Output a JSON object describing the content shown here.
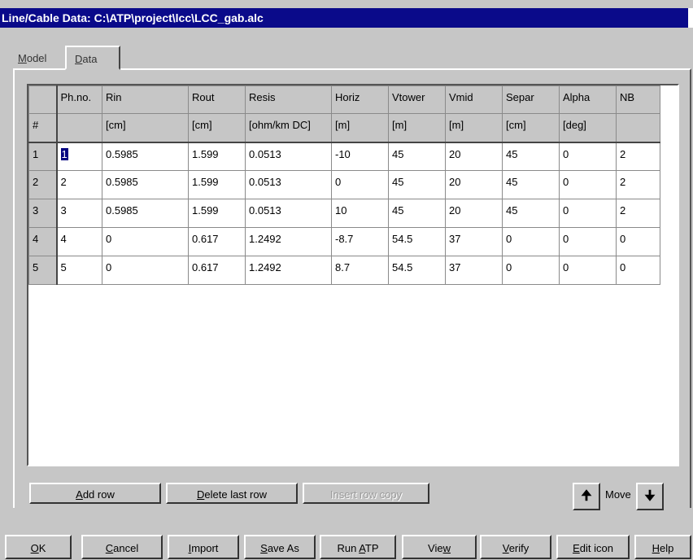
{
  "window": {
    "title": "Line/Cable Data: C:\\ATP\\project\\lcc\\LCC_gab.alc"
  },
  "tabs": [
    {
      "label": "Model",
      "accel": "M",
      "rest": "odel"
    },
    {
      "label": "Data",
      "accel": "D",
      "rest": "ata"
    }
  ],
  "grid": {
    "header": [
      "",
      "Ph.no.",
      "Rin",
      "Rout",
      "Resis",
      "Horiz",
      "Vtower",
      "Vmid",
      "Separ",
      "Alpha",
      "NB"
    ],
    "units": [
      "#",
      "",
      "[cm]",
      "[cm]",
      "[ohm/km DC]",
      "[m]",
      "[m]",
      "[m]",
      "[cm]",
      "[deg]",
      ""
    ],
    "rows": [
      [
        "1",
        "1",
        "0.5985",
        "1.599",
        "0.0513",
        "-10",
        "45",
        "20",
        "45",
        "0",
        "2"
      ],
      [
        "2",
        "2",
        "0.5985",
        "1.599",
        "0.0513",
        "0",
        "45",
        "20",
        "45",
        "0",
        "2"
      ],
      [
        "3",
        "3",
        "0.5985",
        "1.599",
        "0.0513",
        "10",
        "45",
        "20",
        "45",
        "0",
        "2"
      ],
      [
        "4",
        "4",
        "0",
        "0.617",
        "1.2492",
        "-8.7",
        "54.5",
        "37",
        "0",
        "0",
        "0"
      ],
      [
        "5",
        "5",
        "0",
        "0.617",
        "1.2492",
        "8.7",
        "54.5",
        "37",
        "0",
        "0",
        "0"
      ]
    ]
  },
  "row_buttons": {
    "add": {
      "label": "Add row",
      "accel": "A",
      "rest": "dd row"
    },
    "delete": {
      "label": "Delete last row",
      "accel": "D",
      "rest": "elete last row"
    },
    "insert": {
      "label": "Insert row copy"
    },
    "move_label": "Move",
    "up_icon": "arrow-up-icon",
    "down_icon": "arrow-down-icon"
  },
  "bottom_buttons": [
    {
      "label": "OK",
      "accel": "O",
      "rest": "K"
    },
    {
      "label": "Cancel",
      "accel": "C",
      "rest": "ancel"
    },
    {
      "label": "Import",
      "accel": "I",
      "rest": "mport"
    },
    {
      "label": "Save As",
      "accel": "S",
      "rest": "ave As"
    },
    {
      "label": "Run ATP",
      "pre": "Run ",
      "accel": "A",
      "rest": "TP"
    },
    {
      "label": "View",
      "pre": "Vie",
      "accel": "w",
      "rest": ""
    },
    {
      "label": "Verify",
      "accel": "V",
      "rest": "erify"
    },
    {
      "label": "Edit icon",
      "accel": "E",
      "rest": "dit icon"
    },
    {
      "label": "Help",
      "accel": "H",
      "rest": "elp"
    }
  ],
  "colors": {
    "titlebar": "#0a0a8a",
    "face": "#c6c6c6",
    "selection": "#000080"
  }
}
